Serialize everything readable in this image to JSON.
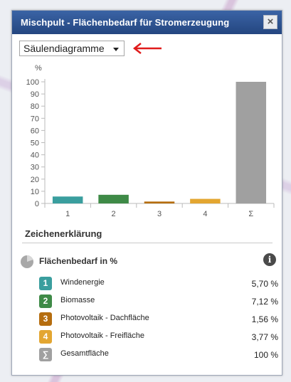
{
  "window": {
    "title": "Mischpult - Flächenbedarf für Stromerzeugung",
    "close_label": "×"
  },
  "view_select": {
    "value": "Säulendiagramme"
  },
  "chart_data": {
    "type": "bar",
    "ylabel": "%",
    "categories": [
      "1",
      "2",
      "3",
      "4",
      "Σ"
    ],
    "values": [
      5.7,
      7.12,
      1.56,
      3.77,
      100
    ],
    "colors": [
      "#3a9e9e",
      "#3e8a47",
      "#b56d0f",
      "#e3a631",
      "#a0a0a0"
    ],
    "ylim": [
      0,
      100
    ],
    "yticks": [
      0,
      10,
      20,
      30,
      40,
      50,
      60,
      70,
      80,
      90,
      100
    ],
    "grid": false,
    "legend": "none"
  },
  "legend": {
    "heading": "Zeichenerklärung",
    "title": "Flächenbedarf in %",
    "icons": {
      "pie": "pie-chart-icon",
      "info": "info-icon",
      "annotation": "red-arrow-icon"
    },
    "rows": [
      {
        "badge": "1",
        "label": "Windenergie",
        "value": "5,70 %",
        "color": "#3a9e9e"
      },
      {
        "badge": "2",
        "label": "Biomasse",
        "value": "7,12 %",
        "color": "#3e8a47"
      },
      {
        "badge": "3",
        "label": "Photovoltaik - Dachfläche",
        "value": "1,56 %",
        "color": "#b56d0f"
      },
      {
        "badge": "4",
        "label": "Photovoltaik - Freifläche",
        "value": "3,77 %",
        "color": "#e3a631"
      },
      {
        "badge": "∑",
        "label": "Gesamtfläche",
        "value": "100 %",
        "color": "#a0a0a0"
      }
    ]
  }
}
